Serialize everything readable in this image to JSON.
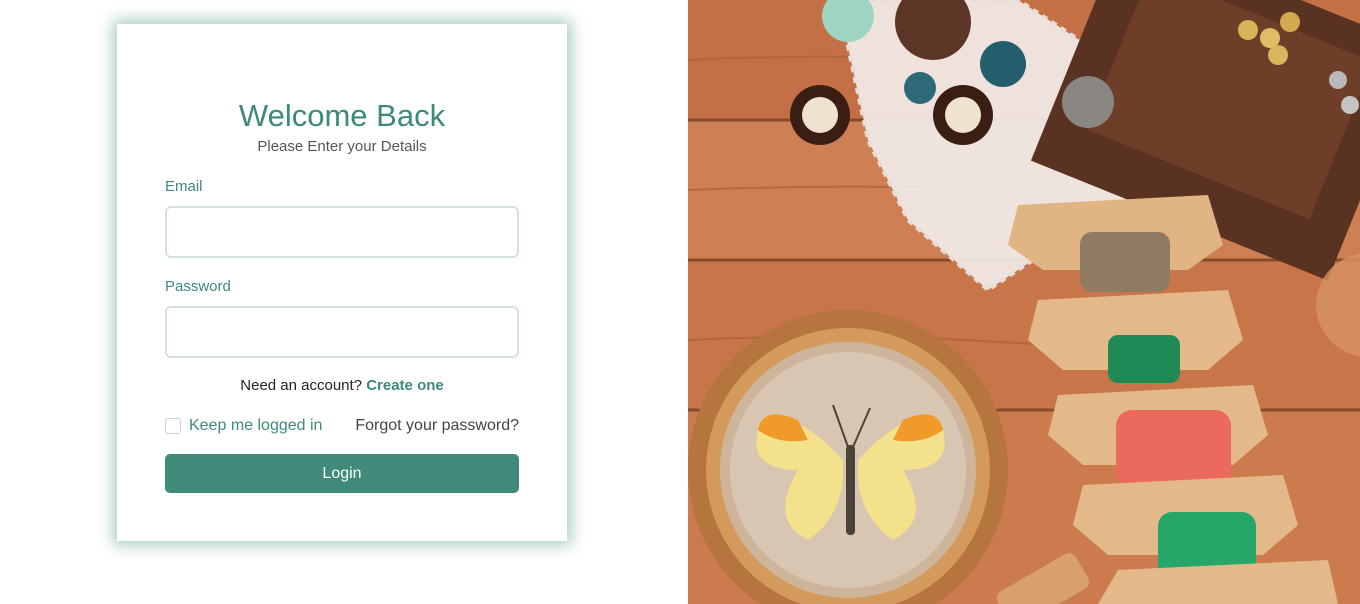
{
  "login": {
    "title": "Welcome Back",
    "subtitle": "Please Enter your Details",
    "email_label": "Email",
    "email_value": "",
    "password_label": "Password",
    "password_value": "",
    "need_account_text": "Need an account?",
    "create_link": "Create one",
    "keep_logged_label": "Keep me logged in",
    "forgot_link": "Forgot your password?",
    "login_button": "Login"
  },
  "colors": {
    "accent": "#3d8a7a",
    "button": "#3f8a78",
    "background": "#ffffff"
  },
  "hero": {
    "image_description_icon": "craft-supplies-image"
  }
}
